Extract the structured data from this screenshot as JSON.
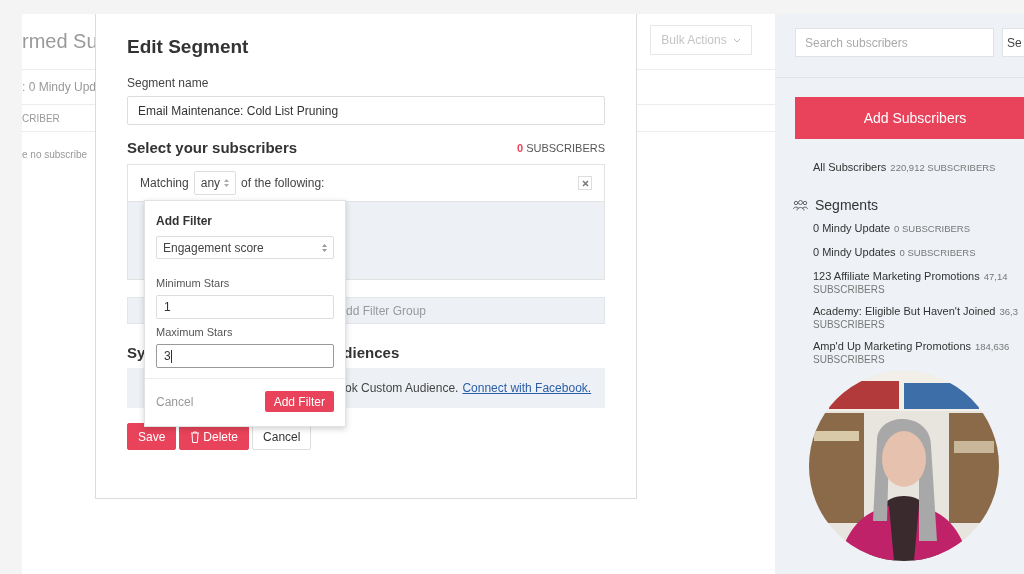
{
  "background": {
    "title_fragment": "rmed Su",
    "breadcrumb_fragment": ": 0 Mindy Upd",
    "column_fragment": "CRIBER",
    "empty_fragment": "e no subscribe",
    "bulk_actions": "Bulk Actions"
  },
  "modal": {
    "title": "Edit Segment",
    "segment_name_label": "Segment name",
    "segment_name_value": "Email Maintenance: Cold List Pruning",
    "subscribers_heading": "Select your subscribers",
    "subscriber_count": "0",
    "subscriber_unit": "SUBSCRIBERS",
    "matching_prefix": "Matching",
    "matching_value": "any",
    "matching_suffix": "of the following:",
    "filter_group_fragment": "dd Filter Group",
    "sync_heading_start": "Sy",
    "sync_heading_end": "diences",
    "facebook_text": "ok Custom Audience.",
    "facebook_link": "Connect with Facebook.",
    "buttons": [
      {
        "label": "Save",
        "kind": "primary"
      },
      {
        "label": "Delete",
        "kind": "danger"
      },
      {
        "label": "Cancel",
        "kind": "plain"
      }
    ]
  },
  "add_filter": {
    "title": "Add Filter",
    "filter_type": "Engagement score",
    "min_label": "Minimum Stars",
    "min_value": "1",
    "max_label": "Maximum Stars",
    "max_value": "3",
    "cancel": "Cancel",
    "submit": "Add Filter"
  },
  "sidebar": {
    "search_placeholder": "Search subscribers",
    "second_field_fragment": "Se",
    "add_button": "Add Subscribers",
    "all_label": "All Subscribers",
    "all_count": "220,912 SUBSCRIBERS",
    "segments_heading": "Segments",
    "segments": [
      {
        "name": "0 Mindy Update",
        "count": "0 SUBSCRIBERS"
      },
      {
        "name": "0 Mindy Updates",
        "count": "0 SUBSCRIBERS"
      },
      {
        "name": "123 Affiliate Marketing Promotions",
        "count": "47,14",
        "unit": "SUBSCRIBERS"
      },
      {
        "name": "Academy: Eligible But Haven't Joined",
        "count": "36,3",
        "unit": "SUBSCRIBERS"
      },
      {
        "name": "Amp'd Up Marketing Promotions",
        "count": "184,636",
        "unit": "SUBSCRIBERS"
      }
    ]
  }
}
